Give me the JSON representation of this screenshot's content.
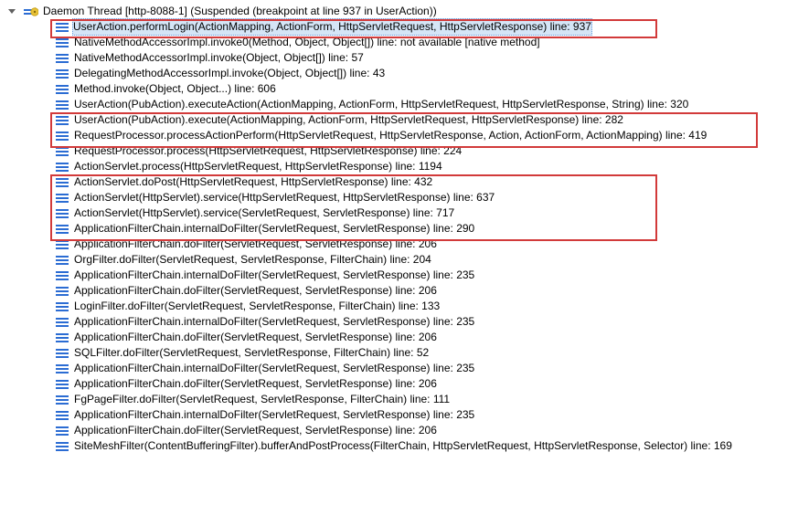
{
  "thread": {
    "label": "Daemon Thread [http-8088-1] (Suspended (breakpoint at line 937 in UserAction))"
  },
  "frames": [
    {
      "text": "UserAction.performLogin(ActionMapping, ActionForm, HttpServletRequest, HttpServletResponse) line: 937",
      "selected": true
    },
    {
      "text": "NativeMethodAccessorImpl.invoke0(Method, Object, Object[]) line: not available [native method]"
    },
    {
      "text": "NativeMethodAccessorImpl.invoke(Object, Object[]) line: 57"
    },
    {
      "text": "DelegatingMethodAccessorImpl.invoke(Object, Object[]) line: 43"
    },
    {
      "text": "Method.invoke(Object, Object...) line: 606"
    },
    {
      "text": "UserAction(PubAction).executeAction(ActionMapping, ActionForm, HttpServletRequest, HttpServletResponse, String) line: 320"
    },
    {
      "text": "UserAction(PubAction).execute(ActionMapping, ActionForm, HttpServletRequest, HttpServletResponse) line: 282"
    },
    {
      "text": "RequestProcessor.processActionPerform(HttpServletRequest, HttpServletResponse, Action, ActionForm, ActionMapping) line: 419"
    },
    {
      "text": "RequestProcessor.process(HttpServletRequest, HttpServletResponse) line: 224"
    },
    {
      "text": "ActionServlet.process(HttpServletRequest, HttpServletResponse) line: 1194"
    },
    {
      "text": "ActionServlet.doPost(HttpServletRequest, HttpServletResponse) line: 432"
    },
    {
      "text": "ActionServlet(HttpServlet).service(HttpServletRequest, HttpServletResponse) line: 637"
    },
    {
      "text": "ActionServlet(HttpServlet).service(ServletRequest, ServletResponse) line: 717"
    },
    {
      "text": "ApplicationFilterChain.internalDoFilter(ServletRequest, ServletResponse) line: 290"
    },
    {
      "text": "ApplicationFilterChain.doFilter(ServletRequest, ServletResponse) line: 206"
    },
    {
      "text": "OrgFilter.doFilter(ServletRequest, ServletResponse, FilterChain) line: 204"
    },
    {
      "text": "ApplicationFilterChain.internalDoFilter(ServletRequest, ServletResponse) line: 235"
    },
    {
      "text": "ApplicationFilterChain.doFilter(ServletRequest, ServletResponse) line: 206"
    },
    {
      "text": "LoginFilter.doFilter(ServletRequest, ServletResponse, FilterChain) line: 133"
    },
    {
      "text": "ApplicationFilterChain.internalDoFilter(ServletRequest, ServletResponse) line: 235"
    },
    {
      "text": "ApplicationFilterChain.doFilter(ServletRequest, ServletResponse) line: 206"
    },
    {
      "text": "SQLFilter.doFilter(ServletRequest, ServletResponse, FilterChain) line: 52"
    },
    {
      "text": "ApplicationFilterChain.internalDoFilter(ServletRequest, ServletResponse) line: 235"
    },
    {
      "text": "ApplicationFilterChain.doFilter(ServletRequest, ServletResponse) line: 206"
    },
    {
      "text": "FgPageFilter.doFilter(ServletRequest, ServletResponse, FilterChain) line: 111"
    },
    {
      "text": "ApplicationFilterChain.internalDoFilter(ServletRequest, ServletResponse) line: 235"
    },
    {
      "text": "ApplicationFilterChain.doFilter(ServletRequest, ServletResponse) line: 206"
    },
    {
      "text": "SiteMeshFilter(ContentBufferingFilter).bufferAndPostProcess(FilterChain, HttpServletRequest, HttpServletResponse, Selector) line: 169"
    }
  ]
}
